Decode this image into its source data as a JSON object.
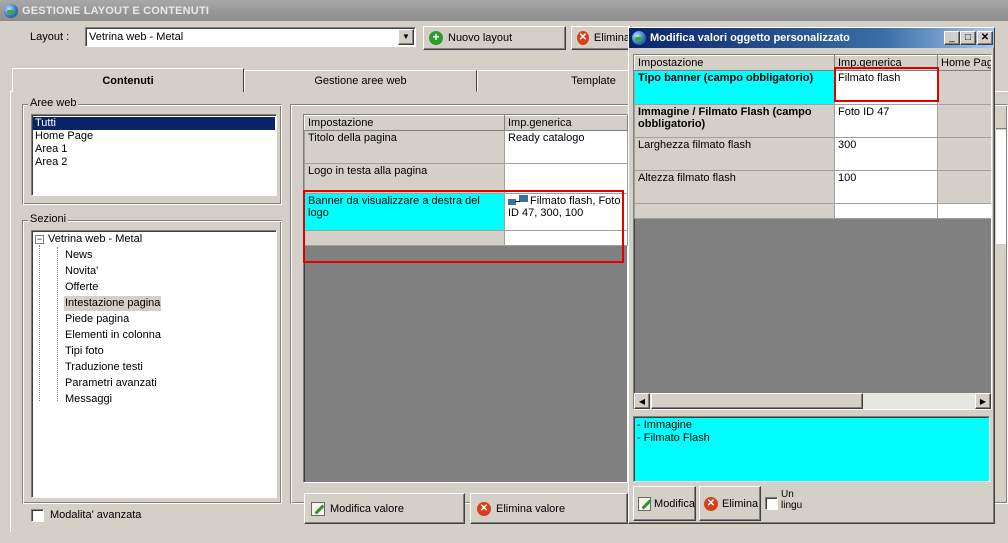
{
  "window": {
    "title": "GESTIONE LAYOUT E CONTENUTI"
  },
  "toolbar": {
    "layout_label": "Layout :",
    "layout_value": "Vetrina web - Metal",
    "new_layout": "Nuovo layout",
    "delete_layout": "Elimina"
  },
  "tabs": [
    {
      "label": "Contenuti"
    },
    {
      "label": "Gestione aree web"
    },
    {
      "label": "Template"
    }
  ],
  "aree_web": {
    "label": "Aree web",
    "items": [
      "Tutti",
      "Home Page",
      "Area 1",
      "Area 2"
    ]
  },
  "sezioni": {
    "label": "Sezioni",
    "root": "Vetrina web - Metal",
    "items": [
      "News",
      "Novita'",
      "Offerte",
      "Intestazione pagina",
      "Piede pagina",
      "Elementi in colonna",
      "Tipi foto",
      "Traduzione testi",
      "Parametri avanzati",
      "Messaggi"
    ]
  },
  "advanced_mode": "Modalita' avanzata",
  "main_grid": {
    "headers": [
      "Impostazione",
      "Imp.generica"
    ],
    "rows": [
      {
        "setting": "Titolo della pagina",
        "value": "Ready catalogo"
      },
      {
        "setting": "Logo in testa alla pagina",
        "value": ""
      },
      {
        "setting": "Banner da visualizzare a destra del logo",
        "value": "Filmato flash, Foto ID 47, 300, 100"
      }
    ]
  },
  "main_buttons": {
    "edit": "Modifica valore",
    "delete": "Elimina valore"
  },
  "dialog": {
    "title": "Modifica valori oggetto personalizzato",
    "headers": [
      "Impostazione",
      "Imp.generica",
      "Home Pag"
    ],
    "rows": [
      {
        "setting": "Tipo banner (campo obbligatorio)",
        "value": "Filmato flash"
      },
      {
        "setting": "Immagine / Filmato Flash (campo obbligatorio)",
        "value": "Foto ID 47"
      },
      {
        "setting": "Larghezza filmato flash",
        "value": "300"
      },
      {
        "setting": "Altezza filmato flash",
        "value": "100"
      }
    ],
    "options": [
      "- Immagine",
      "- Filmato Flash"
    ],
    "btn_edit": "Modifica",
    "btn_delete": "Elimina",
    "checkbox_label": "Un lingu"
  }
}
